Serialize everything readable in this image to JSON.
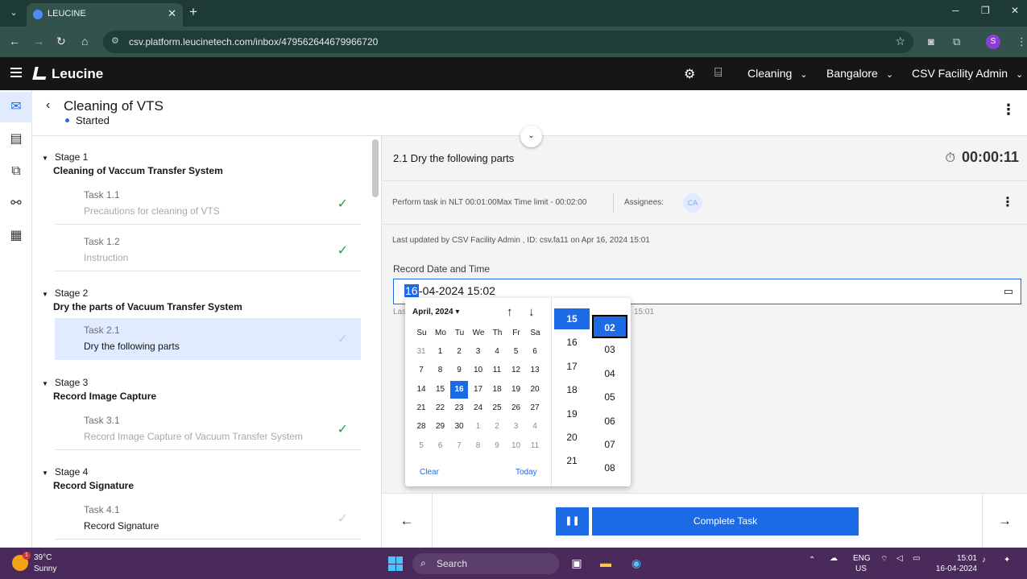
{
  "browser": {
    "tab_title": "LEUCINE",
    "url": "csv.platform.leucinetech.com/inbox/479562644679966720",
    "profile_initial": "S"
  },
  "app": {
    "brand": "Leucine",
    "use_case": "Cleaning",
    "facility": "Bangalore",
    "user": "CSV Facility Admin"
  },
  "job": {
    "title": "Cleaning of VTS",
    "status": "Started"
  },
  "stages": [
    {
      "name": "Stage 1",
      "desc": "Cleaning of Vaccum Transfer System",
      "tasks": [
        {
          "num": "Task 1.1",
          "desc": "Precautions for cleaning of VTS",
          "state": "done"
        },
        {
          "num": "Task 1.2",
          "desc": "Instruction",
          "state": "done"
        }
      ]
    },
    {
      "name": "Stage 2",
      "desc": "Dry the parts of Vacuum Transfer System",
      "tasks": [
        {
          "num": "Task 2.1",
          "desc": "Dry the following parts",
          "state": "selected"
        }
      ]
    },
    {
      "name": "Stage 3",
      "desc": "Record Image Capture",
      "tasks": [
        {
          "num": "Task 3.1",
          "desc": "Record Image Capture of Vacuum Transfer System",
          "state": "done"
        }
      ]
    },
    {
      "name": "Stage 4",
      "desc": "Record Signature",
      "tasks": [
        {
          "num": "Task 4.1",
          "desc": "Record Signature",
          "state": "pending"
        }
      ]
    }
  ],
  "task": {
    "title": "2.1 Dry the following parts",
    "timer": "00:00:11",
    "time_limit": "Perform task in NLT 00:01:00Max Time limit - 00:02:00",
    "assignees_label": "Assignees:",
    "assignee_initials": "CA",
    "last_updated": "Last updated by CSV Facility Admin , ID: csv.fa11 on Apr 16, 2024 15:01",
    "field_label": "Record Date and Time",
    "field_value_day": "16",
    "field_value_rest": "-04-2024 15:02",
    "behind_text": "Las",
    "behind_time": "15:01"
  },
  "picker": {
    "month": "April, 2024",
    "weekdays": [
      "Su",
      "Mo",
      "Tu",
      "We",
      "Th",
      "Fr",
      "Sa"
    ],
    "weeks": [
      [
        "31",
        "1",
        "2",
        "3",
        "4",
        "5",
        "6"
      ],
      [
        "7",
        "8",
        "9",
        "10",
        "11",
        "12",
        "13"
      ],
      [
        "14",
        "15",
        "16",
        "17",
        "18",
        "19",
        "20"
      ],
      [
        "21",
        "22",
        "23",
        "24",
        "25",
        "26",
        "27"
      ],
      [
        "28",
        "29",
        "30",
        "1",
        "2",
        "3",
        "4"
      ],
      [
        "5",
        "6",
        "7",
        "8",
        "9",
        "10",
        "11"
      ]
    ],
    "selected_day": "16",
    "clear": "Clear",
    "today": "Today",
    "hours": [
      "15",
      "16",
      "17",
      "18",
      "19",
      "20",
      "21"
    ],
    "selected_hour": "15",
    "minutes": [
      "02",
      "03",
      "04",
      "05",
      "06",
      "07",
      "08"
    ],
    "selected_minute": "02"
  },
  "footer": {
    "complete_label": "Complete Task"
  },
  "taskbar": {
    "temp": "39°C",
    "weather": "Sunny",
    "weather_badge": "1",
    "search": "Search",
    "lang1": "ENG",
    "lang2": "US",
    "time": "15:01",
    "date": "16-04-2024"
  }
}
